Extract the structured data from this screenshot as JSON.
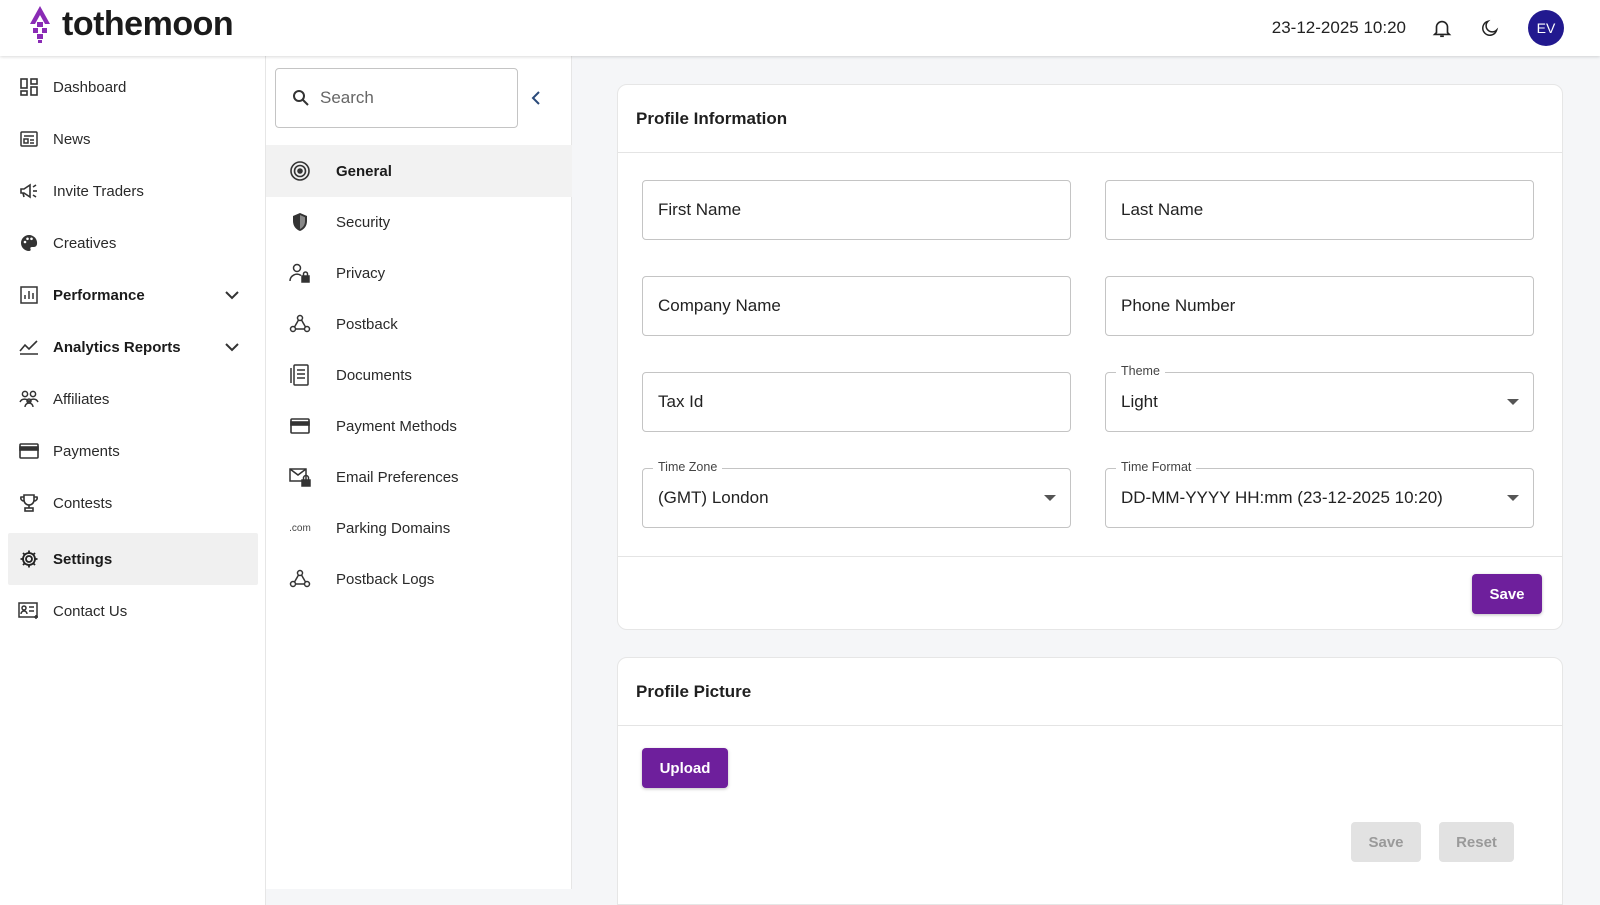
{
  "app": {
    "brand": "tothemoon"
  },
  "header": {
    "datetime": "23-12-2025 10:20",
    "avatar_initials": "EV"
  },
  "colors": {
    "brand": "#6e1f9c",
    "avatar": "#22198f",
    "logo_purple": "#8a2bb5"
  },
  "sidebar": {
    "items": [
      {
        "label": "Dashboard",
        "icon": "dashboard-icon"
      },
      {
        "label": "News",
        "icon": "news-icon"
      },
      {
        "label": "Invite Traders",
        "icon": "campaign-icon"
      },
      {
        "label": "Creatives",
        "icon": "palette-icon"
      },
      {
        "label": "Performance",
        "icon": "bar-chart-icon"
      },
      {
        "label": "Analytics Reports",
        "icon": "line-chart-icon"
      },
      {
        "label": "Affiliates",
        "icon": "group-icon"
      },
      {
        "label": "Payments",
        "icon": "credit-card-icon"
      },
      {
        "label": "Contests",
        "icon": "trophy-icon"
      },
      {
        "label": "Settings",
        "icon": "gear-icon"
      },
      {
        "label": "Contact Us",
        "icon": "contact-card-icon"
      }
    ]
  },
  "settings_nav": {
    "search_placeholder": "Search",
    "items": [
      {
        "label": "General",
        "icon": "target-icon"
      },
      {
        "label": "Security",
        "icon": "shield-icon"
      },
      {
        "label": "Privacy",
        "icon": "person-lock-icon"
      },
      {
        "label": "Postback",
        "icon": "webhook-icon"
      },
      {
        "label": "Documents",
        "icon": "document-icon"
      },
      {
        "label": "Payment Methods",
        "icon": "card-icon"
      },
      {
        "label": "Email Preferences",
        "icon": "mail-lock-icon"
      },
      {
        "label": "Parking Domains",
        "icon": "dotcom-icon",
        "glyph": ".com"
      },
      {
        "label": "Postback Logs",
        "icon": "webhook-icon"
      }
    ]
  },
  "profile_info": {
    "title": "Profile Information",
    "first_name": "First Name",
    "last_name": "Last Name",
    "company_name": "Company Name",
    "phone_number": "Phone Number",
    "tax_id": "Tax Id",
    "theme": {
      "label": "Theme",
      "value": "Light"
    },
    "time_zone": {
      "label": "Time Zone",
      "value": "(GMT) London"
    },
    "time_format": {
      "label": "Time Format",
      "value": "DD-MM-YYYY HH:mm (23-12-2025 10:20)"
    },
    "save_label": "Save"
  },
  "profile_picture": {
    "title": "Profile Picture",
    "upload_label": "Upload",
    "save_label": "Save",
    "reset_label": "Reset"
  }
}
